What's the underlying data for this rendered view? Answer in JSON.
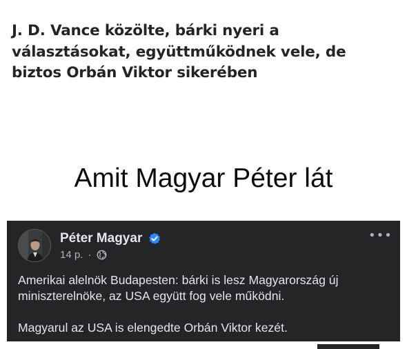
{
  "article": {
    "headline_line1": "J. D. Vance közölte, bárki nyeri a",
    "headline_line2": "választásokat, együttműködnek vele, de",
    "headline_line3": "biztos Orbán Viktor sikerében"
  },
  "caption": "Amit Magyar Péter lát",
  "post": {
    "author": "Péter Magyar",
    "time": "14 p.",
    "separator": "·",
    "privacy_icon": "globe-icon",
    "verified_icon": "verified-badge-icon",
    "more_label": "•••",
    "paragraph1": "Amerikai alelnök Budapesten: bárki is lesz Magyarország új miniszterelnöke, az USA együtt fog vele működni.",
    "paragraph2": "Magyarul az USA is elengedte Orbán Viktor kezét."
  },
  "colors": {
    "card_background": "#242526",
    "primary_text": "#e4e6eb",
    "secondary_text": "#b0b3b8",
    "verified_blue": "#2d88ff",
    "headline_text": "#242424"
  }
}
